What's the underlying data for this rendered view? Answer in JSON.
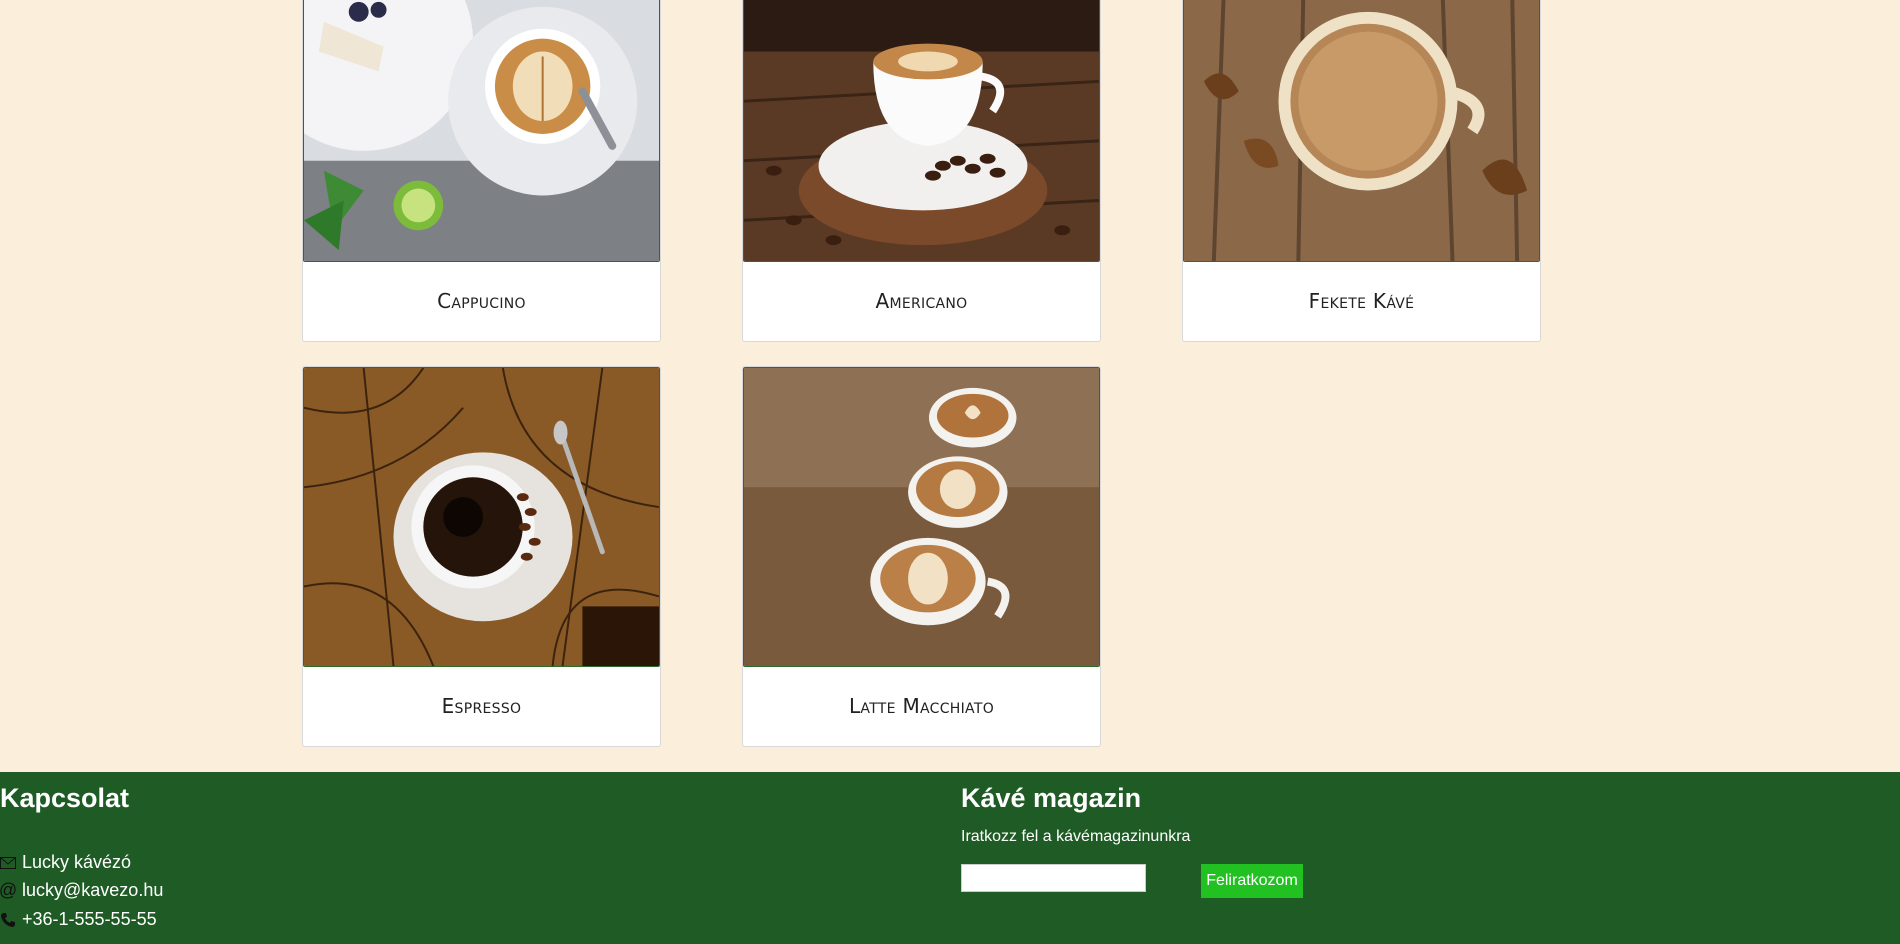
{
  "products": [
    {
      "name": "Cappucino"
    },
    {
      "name": "Americano"
    },
    {
      "name": "Fekete Kávé"
    },
    {
      "name": "Espresso"
    },
    {
      "name": "Latte Macchiato"
    }
  ],
  "footer": {
    "contact": {
      "heading": "Kapcsolat",
      "items": [
        {
          "icon": "envelope-icon",
          "text": "Lucky kávézó"
        },
        {
          "icon": "at-icon",
          "text": "lucky@kavezo.hu"
        },
        {
          "icon": "phone-icon",
          "text": "+36-1-555-55-55"
        }
      ]
    },
    "magazine": {
      "heading": "Kávé magazin",
      "subtitle": "Iratkozz fel a kávémagazinunkra",
      "email_placeholder": "",
      "button_label": "Feliratkozom"
    }
  },
  "colors": {
    "background": "#fbeedb",
    "footer": "#1f5c25",
    "button": "#22c122"
  }
}
